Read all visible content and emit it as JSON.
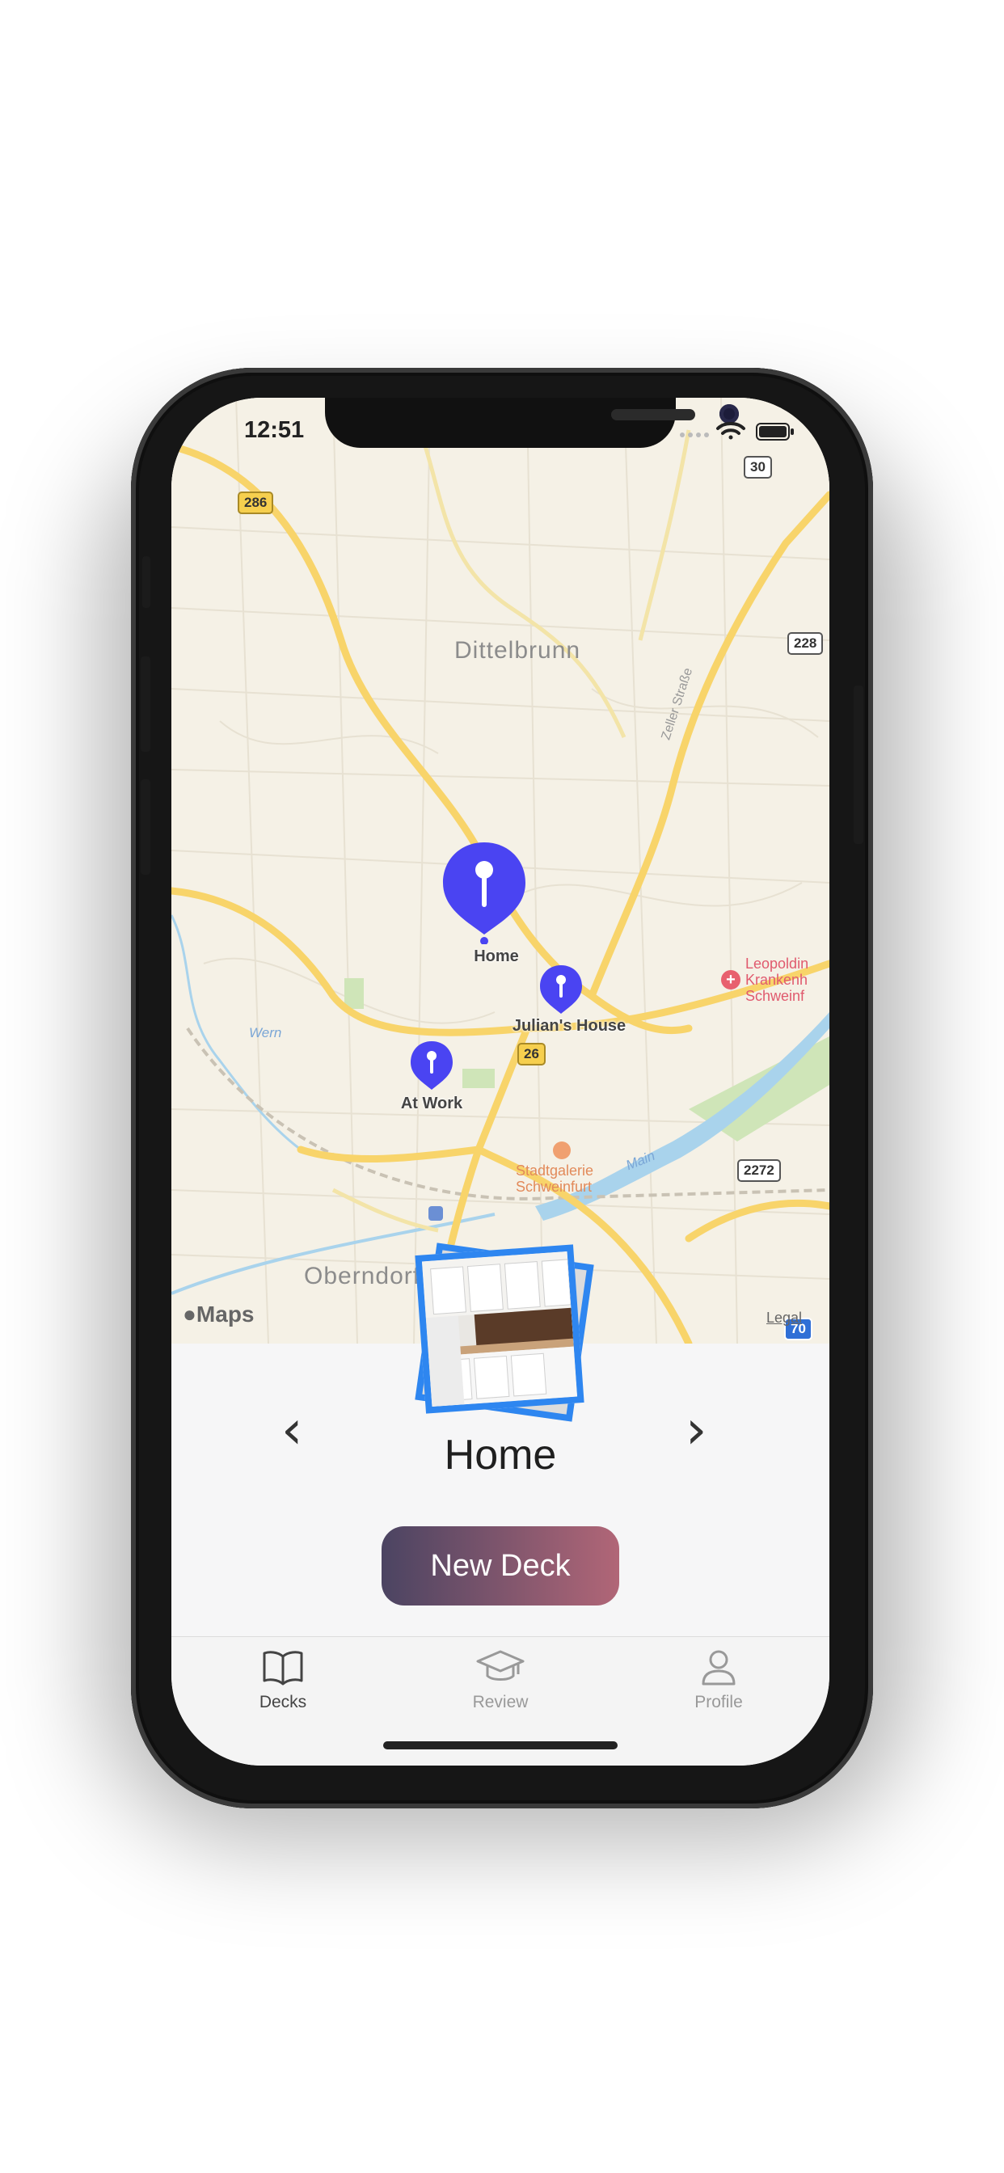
{
  "status_bar": {
    "time": "12:51"
  },
  "map": {
    "places": [
      "Dittelbrunn",
      "Oberndorf"
    ],
    "street": "Zeller Straße",
    "water": [
      "Wern",
      "Main"
    ],
    "poi": [
      "Stadtgalerie",
      "Schweinfurt"
    ],
    "hospital": [
      "Leopoldin",
      "Krankenh",
      "Schweinf"
    ],
    "shields": {
      "r286": "286",
      "r30": "30",
      "r228": "228",
      "r26": "26",
      "r2272": "2272",
      "r70": "70"
    },
    "pins": {
      "home": "Home",
      "julians_house": "Julian's House",
      "at_work": "At Work"
    },
    "maps_label": "Maps",
    "legal": "Legal"
  },
  "deck": {
    "title": "Home",
    "prev": "‹",
    "next": "›"
  },
  "new_deck_button": "New Deck",
  "tabs": [
    {
      "label": "Decks",
      "icon": "book-icon",
      "active": true
    },
    {
      "label": "Review",
      "icon": "graduation-cap-icon",
      "active": false
    },
    {
      "label": "Profile",
      "icon": "person-icon",
      "active": false
    }
  ],
  "colors": {
    "pin": "#4a44f2",
    "accent_start": "#4b4462",
    "accent_end": "#b16677",
    "photo_border": "#2e86f0"
  }
}
